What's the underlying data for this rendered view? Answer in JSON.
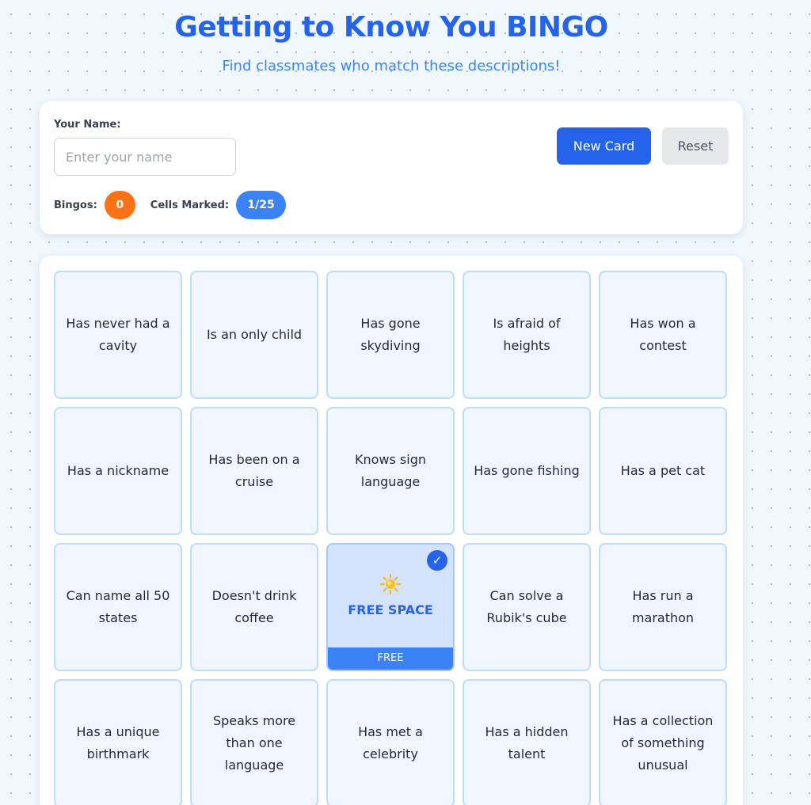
{
  "header": {
    "title": "Getting to Know You BINGO",
    "subtitle": "Find classmates who match these descriptions!"
  },
  "controls": {
    "name_label": "Your Name:",
    "name_placeholder": "Enter your name",
    "name_value": "",
    "new_card_label": "New Card",
    "reset_label": "Reset",
    "bingos_label": "Bingos:",
    "bingos_value": "0",
    "cells_marked_label": "Cells Marked:",
    "cells_marked_value": "1/25"
  },
  "board": {
    "cells": [
      {
        "text": "Has never had a cavity",
        "marked": false
      },
      {
        "text": "Is an only child",
        "marked": false
      },
      {
        "text": "Has gone skydiving",
        "marked": false
      },
      {
        "text": "Is afraid of heights",
        "marked": false
      },
      {
        "text": "Has won a contest",
        "marked": false
      },
      {
        "text": "Has a nickname",
        "marked": false
      },
      {
        "text": "Has been on a cruise",
        "marked": false
      },
      {
        "text": "Knows sign language",
        "marked": false
      },
      {
        "text": "Has gone fishing",
        "marked": false
      },
      {
        "text": "Has a pet cat",
        "marked": false
      },
      {
        "text": "Can name all 50 states",
        "marked": false
      },
      {
        "text": "Doesn't drink coffee",
        "marked": false
      },
      {
        "text": "FREE SPACE",
        "marked": true,
        "free": true,
        "band": "FREE",
        "icon": "sun-icon",
        "check": "✓"
      },
      {
        "text": "Can solve a Rubik's cube",
        "marked": false
      },
      {
        "text": "Has run a marathon",
        "marked": false
      },
      {
        "text": "Has a unique birthmark",
        "marked": false
      },
      {
        "text": "Speaks more than one language",
        "marked": false
      },
      {
        "text": "Has met a celebrity",
        "marked": false
      },
      {
        "text": "Has a hidden talent",
        "marked": false
      },
      {
        "text": "Has a collection of something unusual",
        "marked": false
      }
    ]
  },
  "colors": {
    "primary": "#2563eb",
    "accent_orange": "#f97316",
    "cell_bg": "#eff6ff",
    "cell_border": "#bfdbfe",
    "free_bg": "#d3e3fd"
  }
}
